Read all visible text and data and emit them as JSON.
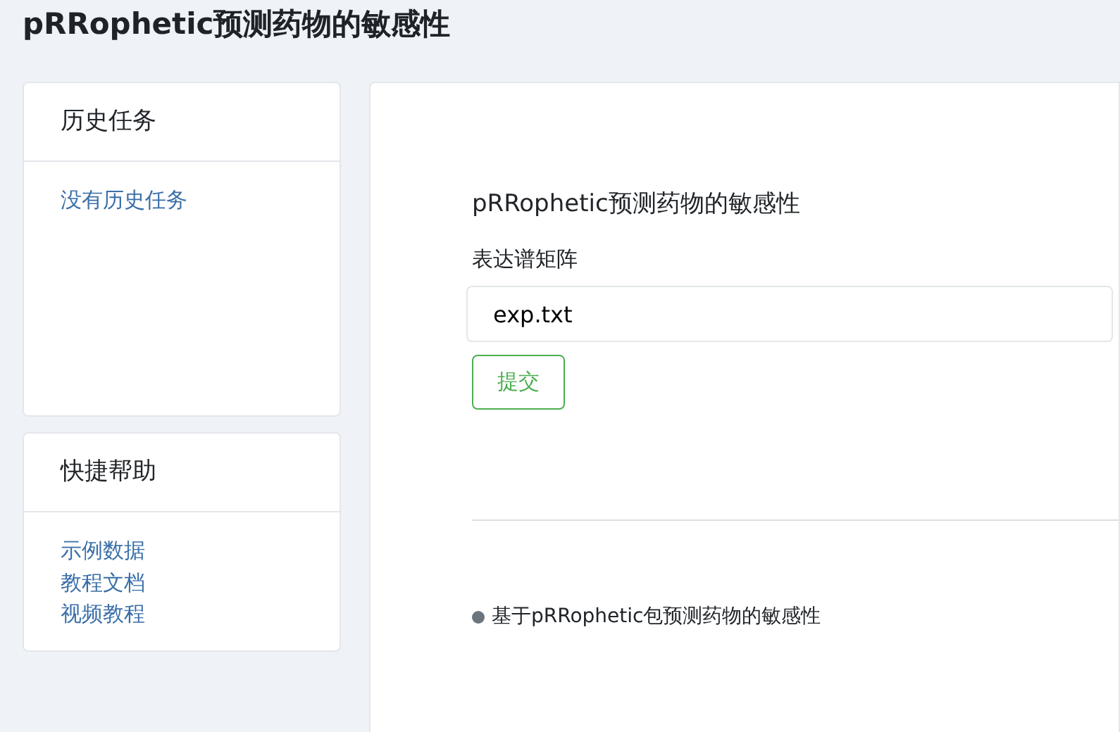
{
  "page_title": "pRRophetic预测药物的敏感性",
  "sidebar": [
    {
      "title": "历史任务",
      "links": [
        "没有历史任务"
      ]
    },
    {
      "title": "快捷帮助",
      "links": [
        "示例数据",
        "教程文档",
        "视频教程"
      ]
    }
  ],
  "form": {
    "title": "pRRophetic预测药物的敏感性",
    "field_label": "表达谱矩阵",
    "field_value": "exp.txt",
    "submit": "提交"
  },
  "notes": [
    "基于pRRophetic包预测药物的敏感性"
  ]
}
